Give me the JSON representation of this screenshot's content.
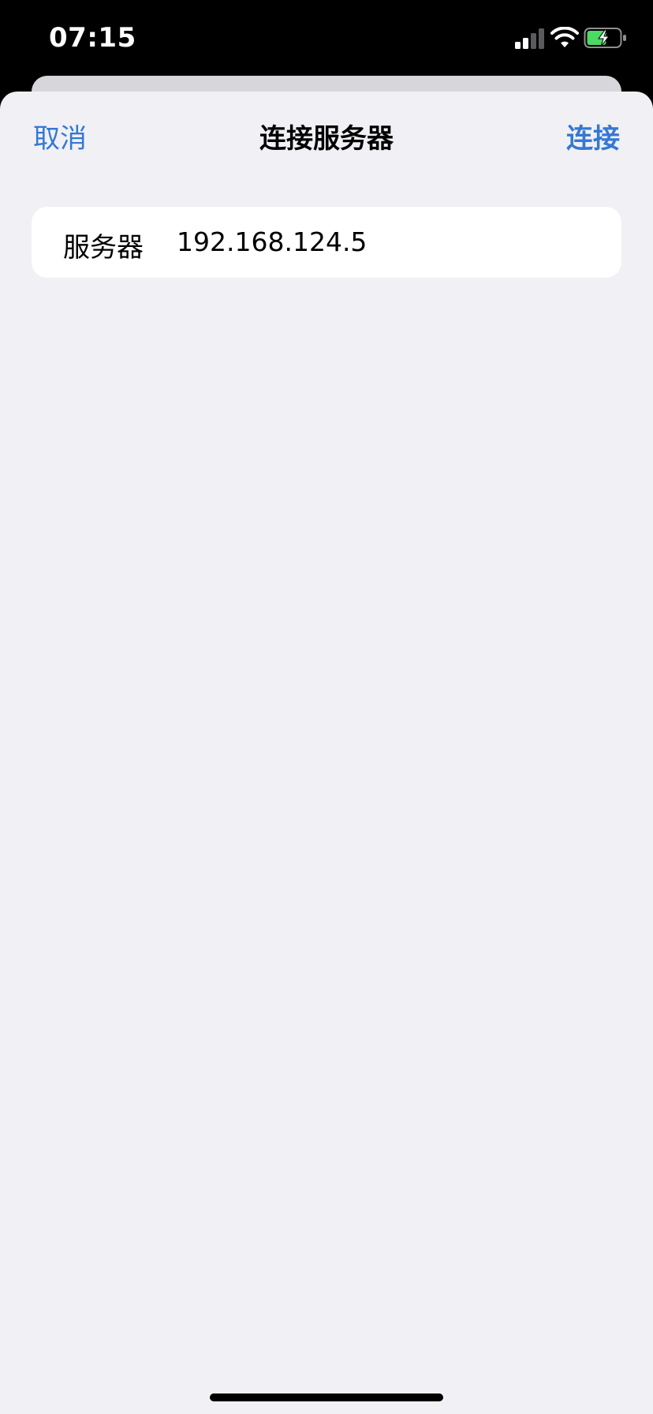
{
  "status_bar": {
    "time": "07:15",
    "icons": [
      "cellular-signal-icon",
      "wifi-icon",
      "battery-charging-icon"
    ]
  },
  "nav": {
    "cancel_label": "取消",
    "title": "连接服务器",
    "connect_label": "连接"
  },
  "form": {
    "server_label": "服务器",
    "server_value": "192.168.124.5"
  },
  "colors": {
    "accent": "#3478d2",
    "sheet_background": "#f0f0f5",
    "card_background": "#ffffff",
    "battery_fill": "#4cd964"
  }
}
